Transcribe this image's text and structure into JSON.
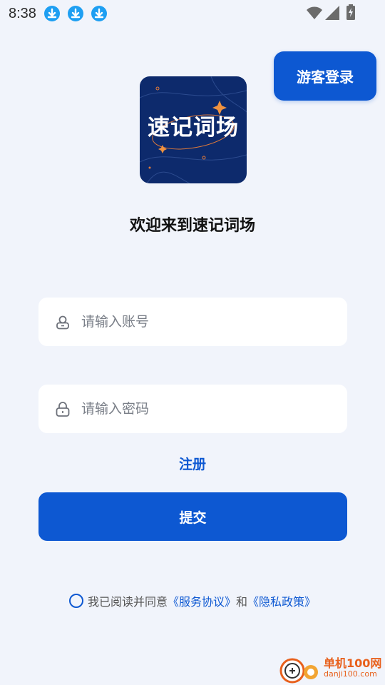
{
  "status_bar": {
    "time": "8:38",
    "download_icons": [
      "download-icon",
      "download-icon",
      "download-icon"
    ],
    "system_icons": [
      "wifi-icon",
      "signal-icon",
      "battery-charging-icon"
    ]
  },
  "guest_login": {
    "label": "游客登录"
  },
  "logo": {
    "text": "速记词场"
  },
  "welcome": "欢迎来到速记词场",
  "form": {
    "account": {
      "placeholder": "请输入账号",
      "icon": "user-icon"
    },
    "password": {
      "placeholder": "请输入密码",
      "icon": "lock-icon"
    },
    "register_label": "注册",
    "submit_label": "提交"
  },
  "agreement": {
    "prefix": "我已阅读并同意",
    "service_link": "《服务协议》",
    "and": "和",
    "privacy_link": "《隐私政策》"
  },
  "watermark": {
    "text": "单机100网",
    "sub": "danji100.com"
  },
  "colors": {
    "accent": "#0d58d2",
    "background": "#f1f4fb",
    "logo_bg": "#0d2a6c"
  }
}
